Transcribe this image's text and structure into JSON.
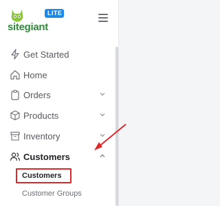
{
  "app": {
    "logo_text": "sitegiant",
    "logo_badge": "LITE"
  },
  "sidebar": {
    "items": [
      {
        "label": "Get Started",
        "icon": "lightning-icon",
        "has_chevron": false
      },
      {
        "label": "Home",
        "icon": "home-icon",
        "has_chevron": false
      },
      {
        "label": "Orders",
        "icon": "clipboard-icon",
        "has_chevron": true
      },
      {
        "label": "Products",
        "icon": "box-icon",
        "has_chevron": true
      },
      {
        "label": "Inventory",
        "icon": "archive-icon",
        "has_chevron": true
      },
      {
        "label": "Customers",
        "icon": "users-icon",
        "has_chevron": true,
        "expanded": true
      }
    ],
    "sub_items": [
      {
        "label": "Customers",
        "selected": true
      },
      {
        "label": "Customer Groups",
        "selected": false
      }
    ]
  },
  "colors": {
    "brand_green": "#8dc63f",
    "badge_blue": "#1e88e5",
    "annotation_red": "#e02727"
  }
}
